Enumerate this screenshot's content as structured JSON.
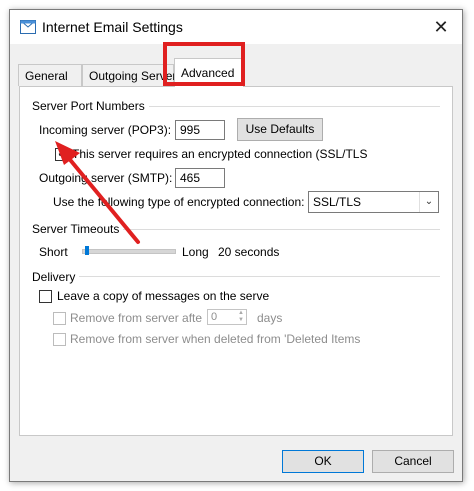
{
  "window": {
    "title": "Internet Email Settings",
    "icon": "mail-icon",
    "close_glyph": "✕"
  },
  "tabs": [
    {
      "label": "General",
      "active": false
    },
    {
      "label": "Outgoing Server",
      "active": false
    },
    {
      "label": "Advanced",
      "active": true
    }
  ],
  "server_ports": {
    "group_label": "Server Port Numbers",
    "incoming_label": "Incoming server (POP3):",
    "incoming_value": "995",
    "use_defaults_label": "Use Defaults",
    "ssl_checkbox_label": "This server requires an encrypted connection (SSL/TLS",
    "ssl_checked": true,
    "outgoing_label": "Outgoing server (SMTP):",
    "outgoing_value": "465",
    "encryption_label": "Use the following type of encrypted connection:",
    "encryption_value": "SSL/TLS"
  },
  "timeouts": {
    "group_label": "Server Timeouts",
    "short_label": "Short",
    "long_label": "Long",
    "value_text": "20 seconds",
    "slider_fraction": 0.03
  },
  "delivery": {
    "group_label": "Delivery",
    "leave_copy_label": "Leave a copy of messages on the serve",
    "leave_copy_checked": false,
    "remove_after_label": "Remove from server afte",
    "remove_after_value": "0",
    "days_label": "days",
    "remove_deleted_label": "Remove from server when deleted from 'Deleted Items"
  },
  "footer": {
    "ok_label": "OK",
    "cancel_label": "Cancel"
  },
  "colors": {
    "annotation_red": "#e02020",
    "accent_blue": "#0078d7"
  }
}
